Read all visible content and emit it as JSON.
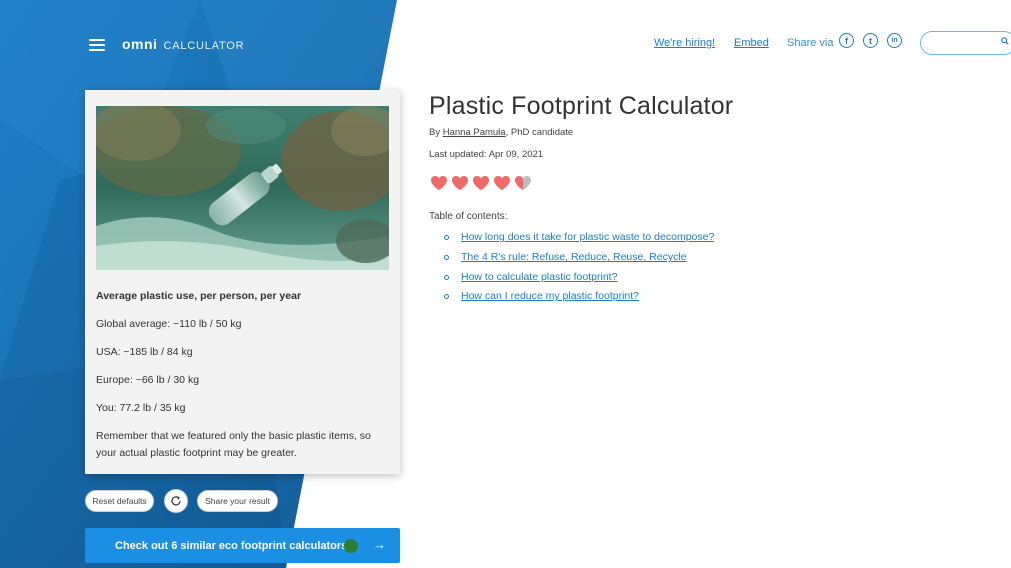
{
  "header": {
    "logo_primary": "omni",
    "logo_secondary": "CALCULATOR",
    "hiring_link": "We're hiring!",
    "embed_link": "Embed",
    "share_label": "Share via",
    "social_icons": [
      {
        "name": "facebook-icon",
        "glyph": "f"
      },
      {
        "name": "twitter-icon",
        "glyph": "t"
      },
      {
        "name": "linkedin-icon",
        "glyph": "in"
      }
    ],
    "search_placeholder": ""
  },
  "sidebar": {
    "heading": "Average plastic use, per person, per year",
    "stats": [
      "Global average: ~110 lb / 50 kg",
      "USA: ~185 lb / 84 kg",
      "Europe: ~66 lb / 30 kg",
      "You: 77.2 lb / 35 kg"
    ],
    "note_line1": "Remember that we featured only the basic plastic items, so",
    "note_line2": "your actual plastic footprint may be greater.",
    "reset_label": "Reset defaults",
    "share_result_label": "Share your result",
    "cta_label": "Check out 6 similar eco footprint calculators",
    "cta_arrow": "→"
  },
  "main": {
    "title": "Plastic Footprint Calculator",
    "by_prefix": "By ",
    "author": "Hanna Pamuła",
    "author_suffix": ", PhD candidate",
    "last_updated": "Last updated: Apr 09, 2021",
    "rating": 4.5,
    "rating_max": 5,
    "toc_label": "Table of contents:",
    "toc": [
      "How long does it take for plastic waste to decompose?",
      "The 4 R's rule: Refuse, Reduce, Reuse, Recycle",
      "How to calculate plastic footprint?",
      "How can I reduce my plastic footprint?"
    ]
  },
  "colors": {
    "brand_blue": "#1a8fe3",
    "link_blue": "#1a7ec8",
    "heart_red": "#f06a6a",
    "heart_gray": "#bdbdbd"
  }
}
